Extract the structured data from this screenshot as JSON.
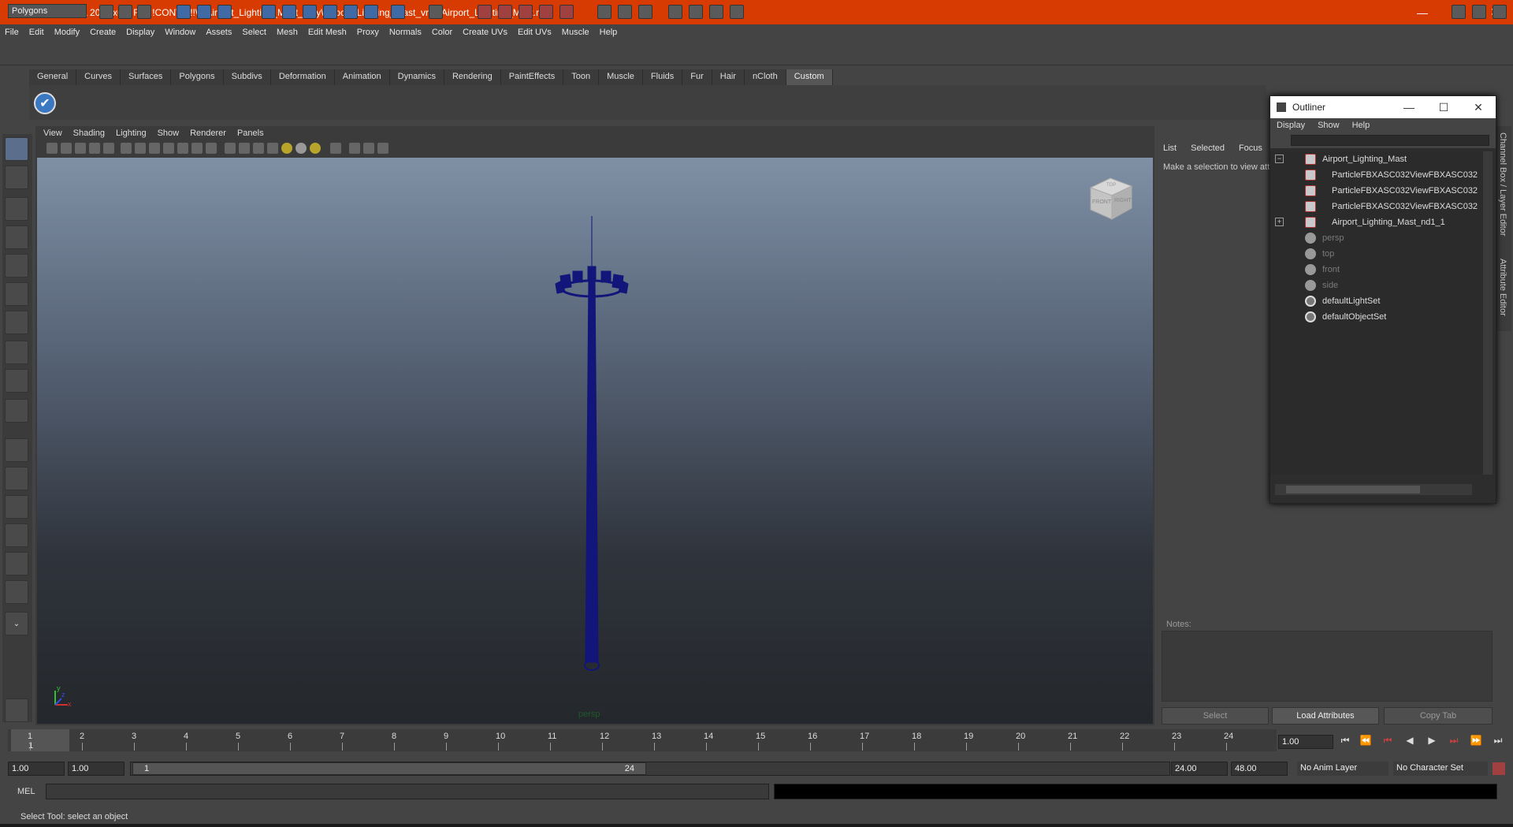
{
  "window": {
    "title": "Autodesk Maya 2011 x64: F:\\!!!!CONV!!!!!\\9\\Airport_Lighting_Mast_vray\\Airport_Lighting_Mast_vray\\Airport_Lighting_Mast.mb*",
    "minimize": "—",
    "maximize": "☐",
    "close": "✕"
  },
  "menubar": [
    "File",
    "Edit",
    "Modify",
    "Create",
    "Display",
    "Window",
    "Assets",
    "Select",
    "Mesh",
    "Edit Mesh",
    "Proxy",
    "Normals",
    "Color",
    "Create UVs",
    "Edit UVs",
    "Muscle",
    "Help"
  ],
  "status": {
    "mode": "Polygons"
  },
  "shelf": {
    "tabs": [
      "General",
      "Curves",
      "Surfaces",
      "Polygons",
      "Subdivs",
      "Deformation",
      "Animation",
      "Dynamics",
      "Rendering",
      "PaintEffects",
      "Toon",
      "Muscle",
      "Fluids",
      "Fur",
      "Hair",
      "nCloth",
      "Custom"
    ],
    "active": "Custom",
    "icon": "✔"
  },
  "viewport": {
    "menu": [
      "View",
      "Shading",
      "Lighting",
      "Show",
      "Renderer",
      "Panels"
    ],
    "camera_label": "persp",
    "viewcube_front": "FRONT",
    "viewcube_right": "RIGHT",
    "viewcube_top": "TOP",
    "axis_x": "x",
    "axis_y": "y",
    "axis_z": "z"
  },
  "attribute_editor": {
    "tabs": [
      "List",
      "Selected",
      "Focus"
    ],
    "message": "Make a selection to view att",
    "notes_label": "Notes:",
    "buttons": {
      "select": "Select",
      "load": "Load Attributes",
      "copy": "Copy Tab"
    },
    "side_tab_1": "Channel Box / Layer Editor",
    "side_tab_2": "Attribute Editor"
  },
  "outliner": {
    "title": "Outliner",
    "menu": [
      "Display",
      "Show",
      "Help"
    ],
    "items": [
      {
        "label": "Airport_Lighting_Mast",
        "type": "mesh"
      },
      {
        "label": "ParticleFBXASC032ViewFBXASC032",
        "type": "mesh"
      },
      {
        "label": "ParticleFBXASC032ViewFBXASC032",
        "type": "mesh"
      },
      {
        "label": "ParticleFBXASC032ViewFBXASC032",
        "type": "mesh"
      },
      {
        "label": "Airport_Lighting_Mast_nd1_1",
        "type": "mesh"
      },
      {
        "label": "persp",
        "type": "camera"
      },
      {
        "label": "top",
        "type": "camera"
      },
      {
        "label": "front",
        "type": "camera"
      },
      {
        "label": "side",
        "type": "camera"
      },
      {
        "label": "defaultLightSet",
        "type": "set"
      },
      {
        "label": "defaultObjectSet",
        "type": "set"
      }
    ]
  },
  "timeline": {
    "ticks": [
      "1",
      "2",
      "3",
      "4",
      "5",
      "6",
      "7",
      "8",
      "9",
      "10",
      "11",
      "12",
      "13",
      "14",
      "15",
      "16",
      "17",
      "18",
      "19",
      "20",
      "21",
      "22",
      "23",
      "24"
    ],
    "current_marker": "1",
    "current_frame": "1.00"
  },
  "range": {
    "start": "1.00",
    "playback_start": "1.00",
    "slider_start": "1",
    "slider_end": "24",
    "playback_end": "24.00",
    "end": "48.00",
    "anim_layer": "No Anim Layer",
    "char_set": "No Character Set"
  },
  "command": {
    "label": "MEL"
  },
  "help": {
    "text": "Select Tool: select an object"
  },
  "colors": {
    "title_bar": "#d83b01",
    "mast": "#12157a"
  }
}
